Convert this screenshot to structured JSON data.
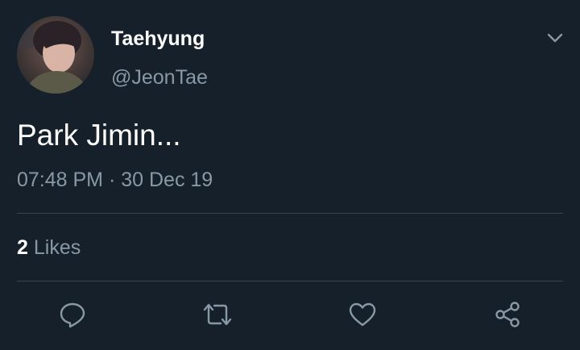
{
  "tweet": {
    "author_name": "Taehyung",
    "author_handle": "@JeonTae",
    "text": "Park Jimin...",
    "time": "07:48 PM",
    "separator": "·",
    "date": "30 Dec 19",
    "likes_count": "2",
    "likes_label": "Likes"
  },
  "icons": {
    "menu": "chevron-down-icon",
    "reply": "reply-icon",
    "retweet": "retweet-icon",
    "like": "like-icon",
    "share": "share-icon"
  },
  "colors": {
    "background": "#15202b",
    "primary_text": "#ffffff",
    "secondary_text": "#8899a6",
    "divider": "#38444d"
  }
}
